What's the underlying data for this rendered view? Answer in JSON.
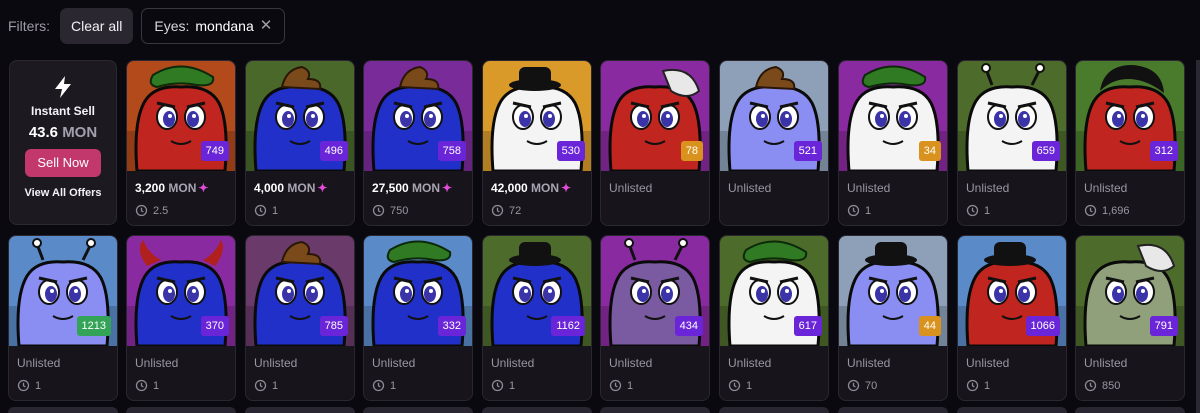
{
  "filters": {
    "label": "Filters:",
    "clear_all": "Clear all",
    "active": {
      "key": "Eyes:",
      "value": "mondana",
      "remove": "✕"
    }
  },
  "instant_sell": {
    "icon": "lightning-bolt-icon",
    "title": "Instant Sell",
    "amount": "43.6",
    "currency": "MON",
    "button": "Sell Now",
    "link": "View All Offers"
  },
  "currency": "MON",
  "colors": {
    "rank_purple": "#6a25d8",
    "rank_orange": "#d9921d",
    "rank_green": "#33a457",
    "accent": "#c2386c",
    "spark": "#e24bd6"
  },
  "row1": [
    {
      "rank": "749",
      "rank_color": "purple",
      "bg": "#b24a1c",
      "body": "#c0251f",
      "hat": "green",
      "price": "3,200",
      "stat": "2.5",
      "listed": true
    },
    {
      "rank": "496",
      "rank_color": "purple",
      "bg": "#49682a",
      "body": "#2130c9",
      "hat": "poop",
      "price": "4,000",
      "stat": "1",
      "listed": true
    },
    {
      "rank": "758",
      "rank_color": "purple",
      "bg": "#7a2b9a",
      "body": "#2130c9",
      "hat": "poop",
      "price": "27,500",
      "stat": "750",
      "listed": true
    },
    {
      "rank": "530",
      "rank_color": "purple",
      "bg": "#d99a2a",
      "body": "#f4f4f4",
      "hat": "black",
      "price": "42,000",
      "stat": "72",
      "listed": true
    },
    {
      "rank": "78",
      "rank_color": "orange",
      "bg": "#8a2aa0",
      "body": "#c0251f",
      "hat": "bandage",
      "price": "",
      "stat": "",
      "listed": false
    },
    {
      "rank": "521",
      "rank_color": "purple",
      "bg": "#8da0b8",
      "body": "#8a8ef2",
      "hat": "poop",
      "price": "",
      "stat": "",
      "listed": false
    },
    {
      "rank": "34",
      "rank_color": "orange",
      "bg": "#8a2aa0",
      "body": "#f4f4f4",
      "hat": "green",
      "price": "",
      "stat": "1",
      "listed": false
    },
    {
      "rank": "659",
      "rank_color": "purple",
      "bg": "#4d6b2a",
      "body": "#f4f4f4",
      "hat": "antenna",
      "price": "",
      "stat": "1",
      "listed": false
    },
    {
      "rank": "312",
      "rank_color": "purple",
      "bg": "#4a7a2c",
      "body": "#c0251f",
      "hat": "hair",
      "price": "",
      "stat": "1,696",
      "listed": false
    }
  ],
  "row2": [
    {
      "rank": "1213",
      "rank_color": "green",
      "bg": "#5a8ac8",
      "body": "#8a8ef2",
      "hat": "antenna",
      "stat": "1"
    },
    {
      "rank": "370",
      "rank_color": "purple",
      "bg": "#8a2aa0",
      "body": "#2130c9",
      "hat": "horns",
      "stat": "1"
    },
    {
      "rank": "785",
      "rank_color": "purple",
      "bg": "#6a3a6a",
      "body": "#2130c9",
      "hat": "poop",
      "stat": "1"
    },
    {
      "rank": "332",
      "rank_color": "purple",
      "bg": "#5a8ac8",
      "body": "#2130c9",
      "hat": "green",
      "stat": "1"
    },
    {
      "rank": "1162",
      "rank_color": "purple",
      "bg": "#4d6b2a",
      "body": "#2130c9",
      "hat": "black",
      "stat": "1"
    },
    {
      "rank": "434",
      "rank_color": "purple",
      "bg": "#8a2aa0",
      "body": "#7a5aa0",
      "hat": "antenna",
      "stat": "1"
    },
    {
      "rank": "617",
      "rank_color": "purple",
      "bg": "#4d6b2a",
      "body": "#f4f4f4",
      "hat": "green",
      "stat": "1"
    },
    {
      "rank": "44",
      "rank_color": "orange",
      "bg": "#8da0b8",
      "body": "#8a8ef2",
      "hat": "black",
      "stat": "70"
    },
    {
      "rank": "1066",
      "rank_color": "purple",
      "bg": "#5a8ac8",
      "body": "#c0251f",
      "hat": "black",
      "stat": "1"
    },
    {
      "rank": "791",
      "rank_color": "purple",
      "bg": "#4d6b2a",
      "body": "#8fa07a",
      "hat": "bandage",
      "stat": "850"
    }
  ],
  "unlisted_label": "Unlisted"
}
